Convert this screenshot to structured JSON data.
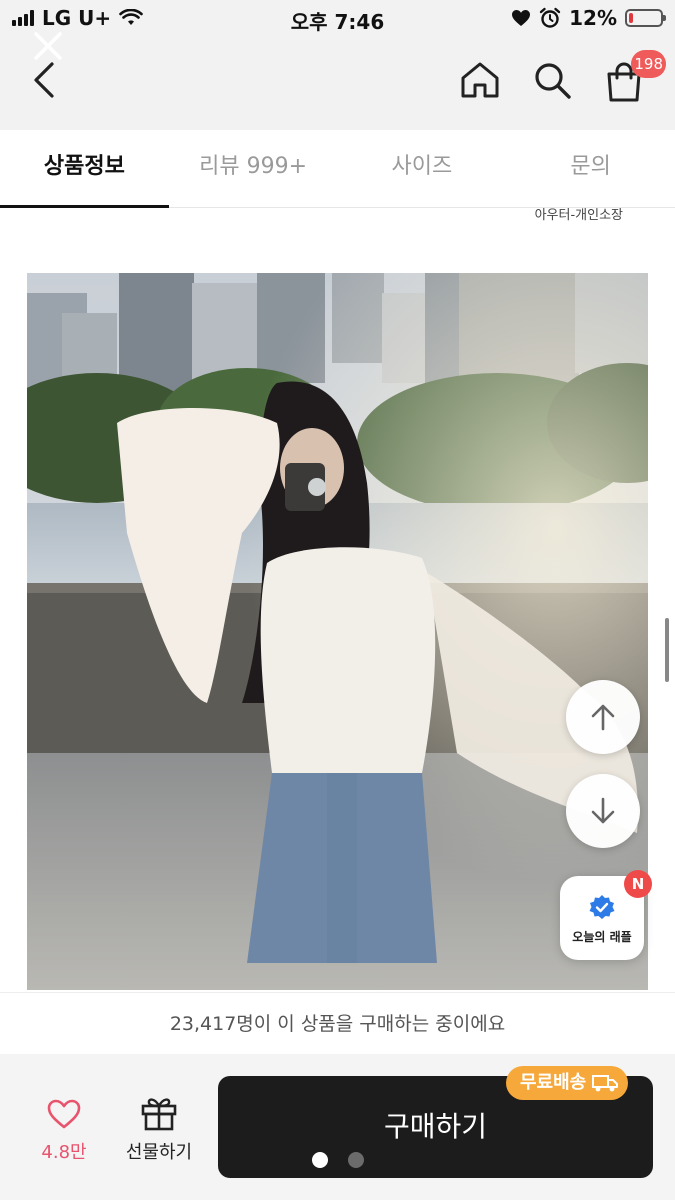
{
  "status_bar": {
    "carrier": "LG U+",
    "time": "오후 7:46",
    "battery_percent": "12%",
    "battery_level": 0.12
  },
  "nav": {
    "cart_count": "198"
  },
  "tabs": [
    {
      "label": "상품정보",
      "active": true
    },
    {
      "label": "리뷰 999+",
      "active": false
    },
    {
      "label": "사이즈",
      "active": false
    },
    {
      "label": "문의",
      "active": false
    }
  ],
  "photo_credit": "아우터-개인소장",
  "floating": {
    "raffle_label": "오늘의 래플",
    "raffle_badge": "N"
  },
  "buying_banner": "23,417명이 이 상품을 구매하는 중이에요",
  "bottom_bar": {
    "like_count": "4.8만",
    "gift_label": "선물하기",
    "buy_label": "구매하기",
    "free_shipping_label": "무료배송",
    "page_dots": 2,
    "active_dot": 0
  },
  "colors": {
    "accent_pink": "#e8546e",
    "badge_red": "#ef5a5a",
    "free_ship_orange": "#f6a83a",
    "buy_button": "#1c1c1c"
  }
}
